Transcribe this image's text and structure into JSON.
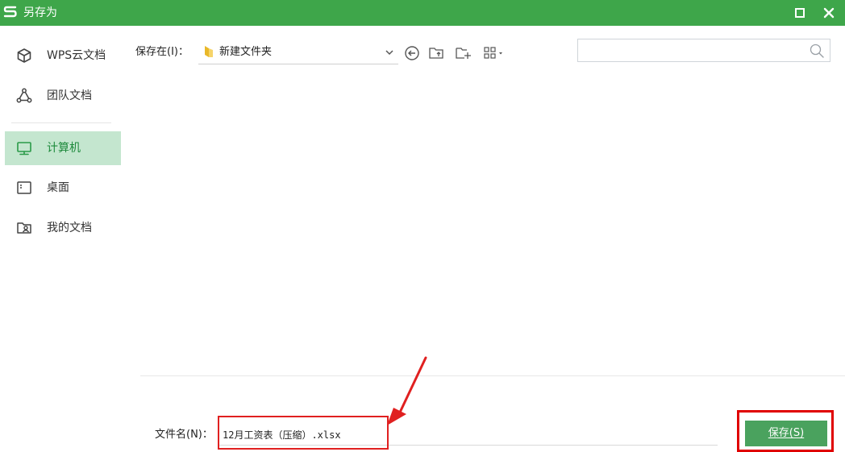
{
  "window": {
    "title": "另存为",
    "accent_color": "#3ea64a",
    "icons": {
      "logo": "wps-logo-icon",
      "maximize": "maximize-icon",
      "close": "close-icon"
    }
  },
  "sidebar": {
    "items": [
      {
        "label": "WPS云文档",
        "icon": "cloud-cube-icon",
        "active": false
      },
      {
        "label": "团队文档",
        "icon": "team-icon",
        "active": false
      },
      {
        "label": "计算机",
        "icon": "computer-icon",
        "active": true
      },
      {
        "label": "桌面",
        "icon": "desktop-icon",
        "active": false
      },
      {
        "label": "我的文档",
        "icon": "my-documents-icon",
        "active": false
      }
    ],
    "active_bg": "#c4e6cf"
  },
  "toolbar": {
    "save_in_label": "保存在(I)：",
    "current_folder": "新建文件夹",
    "search_placeholder": "",
    "icons": [
      "back-icon",
      "up-folder-icon",
      "new-folder-icon",
      "view-mode-icon"
    ]
  },
  "footer": {
    "filename_label": "文件名(N)：",
    "filename_value": "12月工资表（压缩）.xlsx",
    "save_button": "保存(S)",
    "save_button_color": "#4aa25e",
    "annotation_color": "#e00000"
  }
}
